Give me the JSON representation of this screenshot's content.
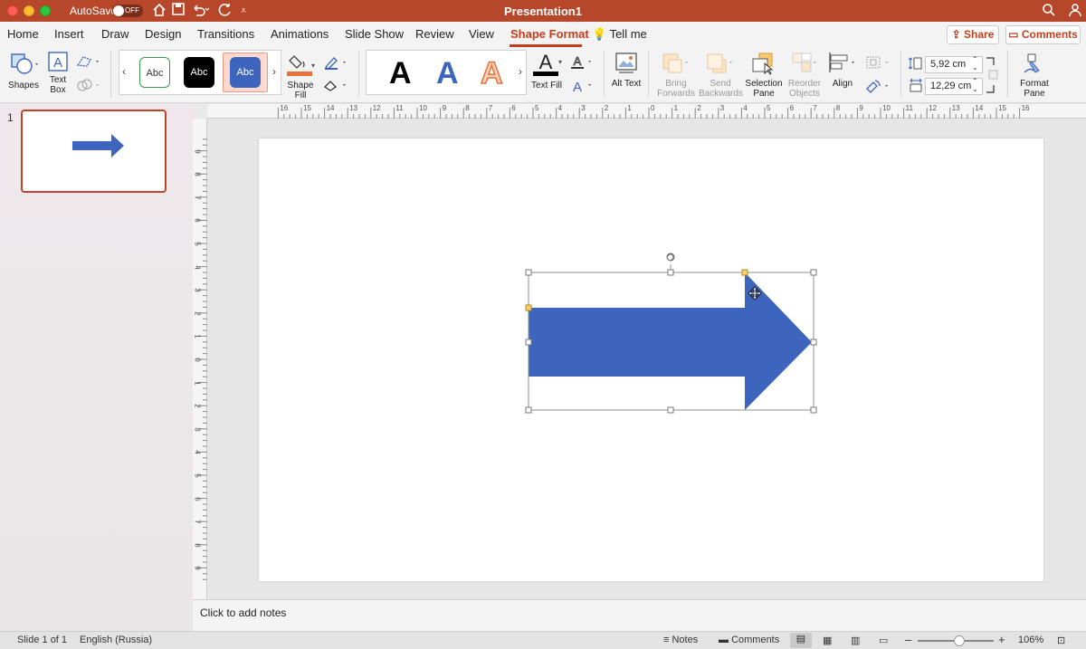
{
  "titlebar": {
    "autosave_label": "AutoSave",
    "autosave_state": "OFF",
    "document_title": "Presentation1"
  },
  "tabs": [
    "Home",
    "Insert",
    "Draw",
    "Design",
    "Transitions",
    "Animations",
    "Slide Show",
    "Review",
    "View",
    "Shape Format"
  ],
  "active_tab": "Shape Format",
  "tell_me": "Tell me",
  "share_label": "Share",
  "comments_label": "Comments",
  "ribbon": {
    "shapes": "Shapes",
    "text_box": "Text Box",
    "style_samples": [
      "Abc",
      "Abc",
      "Abc"
    ],
    "shape_fill": "Shape Fill",
    "wordart_samples": [
      "A",
      "A",
      "A"
    ],
    "text_fill": "Text Fill",
    "alt_text": "Alt Text",
    "bring_forwards": "Bring Forwards",
    "send_backwards": "Send Backwards",
    "selection_pane": "Selection Pane",
    "reorder_objects": "Reorder Objects",
    "align": "Align",
    "height_value": "5,92 cm",
    "width_value": "12,29 cm",
    "format_pane": "Format Pane"
  },
  "slides": [
    {
      "number": "1"
    }
  ],
  "hruler_labels": [
    "16",
    "15",
    "14",
    "13",
    "12",
    "11",
    "10",
    "9",
    "8",
    "7",
    "6",
    "5",
    "4",
    "3",
    "2",
    "1",
    "0",
    "1",
    "2",
    "3",
    "4",
    "5",
    "6",
    "7",
    "8",
    "9",
    "10",
    "11",
    "12",
    "13",
    "14",
    "15",
    "16"
  ],
  "vruler_labels": [
    "9",
    "8",
    "7",
    "6",
    "5",
    "4",
    "3",
    "2",
    "1",
    "0",
    "1",
    "2",
    "3",
    "4",
    "5",
    "6",
    "7",
    "8",
    "9"
  ],
  "notes_placeholder": "Click to add notes",
  "status": {
    "slide_count": "Slide 1 of 1",
    "language": "English (Russia)",
    "notes": "Notes",
    "comments": "Comments",
    "zoom": "106%",
    "zoom_fraction": 0.55
  },
  "colors": {
    "accent": "#c43e1c",
    "titlebar": "#b7472a",
    "arrow_fill": "#3d65bd"
  }
}
